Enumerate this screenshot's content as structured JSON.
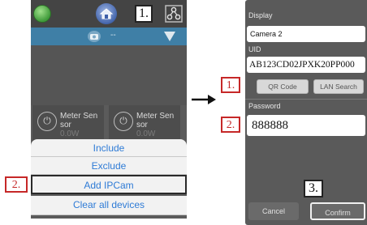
{
  "left_screen": {
    "markers": {
      "step1": "1.",
      "step2": "2."
    },
    "tiles": [
      {
        "name": "Meter Sen sor",
        "watt": "0.0W"
      },
      {
        "name": "Meter Sen sor",
        "watt": "0.0W"
      }
    ],
    "camera_bar": {
      "label": "--"
    },
    "sheet": {
      "include": "Include",
      "exclude": "Exclude",
      "add_ipcam": "Add IPCam",
      "clear_all": "Clear all devices"
    }
  },
  "right_screen": {
    "display_label": "Display",
    "display_value": "Camera 2",
    "uid_label": "UID",
    "uid_value": "AB123CD02JPXK20PP000",
    "qr_code_label": "QR Code",
    "lan_search_label": "LAN Search",
    "password_label": "Password",
    "password_value": "888888",
    "cancel_label": "Cancel",
    "confirm_label": "Confirm",
    "markers": {
      "step1": "1.",
      "step2": "2.",
      "step3": "3."
    }
  },
  "colors": {
    "annotation_red": "#c62828",
    "camera_bar_blue": "#3f7fa6",
    "menu_link_blue": "#2e7bd6"
  },
  "icons": [
    "home-icon",
    "house-icon",
    "share-icon",
    "camera-icon",
    "dropdown-triangle-icon",
    "plug-icon",
    "arrow-right-icon"
  ]
}
